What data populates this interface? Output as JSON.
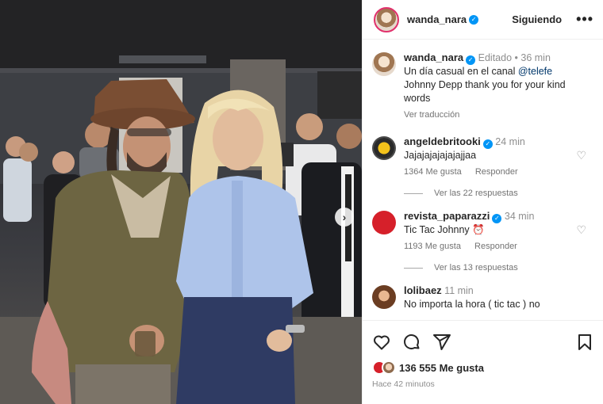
{
  "post_header": {
    "username": "wanda_nara",
    "follow_label": "Siguiendo",
    "more_label": "•••"
  },
  "caption": {
    "username": "wanda_nara",
    "edited": "Editado",
    "time": "36 min",
    "text_prefix": "Un día casual en el canal ",
    "mention": "@telefe",
    "text_line2": "Johnny Depp thank you for your kind words",
    "translate": "Ver traducción"
  },
  "comments": [
    {
      "username": "angeldebritooki",
      "time": "24 min",
      "text": "Jajajajajajajajjaa",
      "likes": "1364 Me gusta",
      "reply": "Responder",
      "replies": "Ver las 22 respuestas"
    },
    {
      "username": "revista_paparazzi",
      "time": "34 min",
      "text": "Tic Tac Johnny ⏰",
      "likes": "1193 Me gusta",
      "reply": "Responder",
      "replies": "Ver las 13 respuestas"
    },
    {
      "username": "lolibaez",
      "time": "11 min",
      "text": "No importa la hora ( tic tac ) no"
    }
  ],
  "footer": {
    "likes": "136 555 Me gusta",
    "posted": "Hace 42 minutos"
  },
  "icons": {
    "like": "heart-icon",
    "comment": "comment-icon",
    "share": "share-icon",
    "save": "bookmark-icon",
    "next": "chevron-right-icon"
  }
}
